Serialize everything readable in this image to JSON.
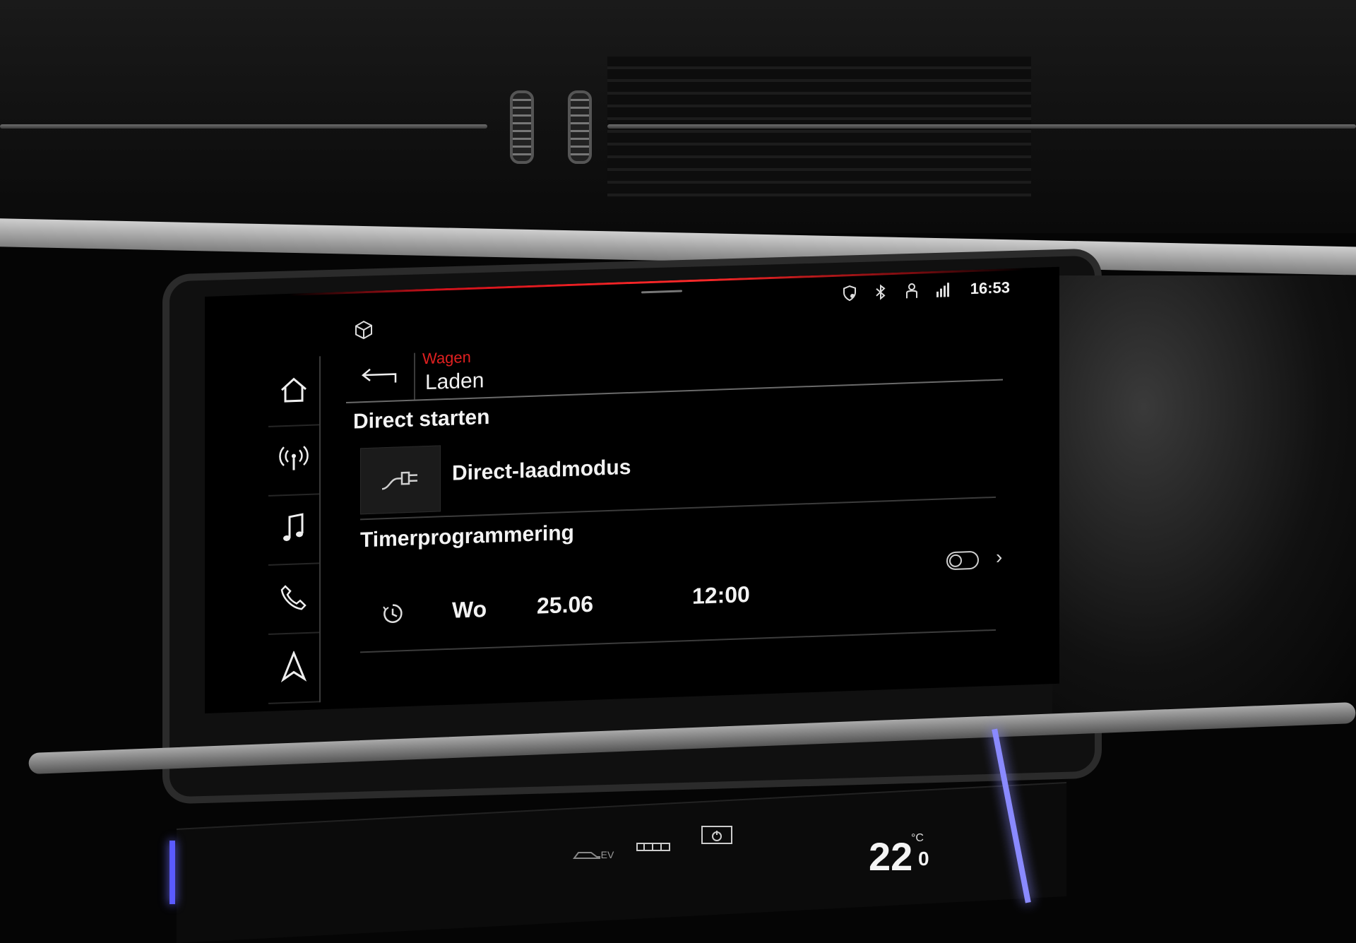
{
  "status_bar": {
    "time": "16:53",
    "icons": [
      "location-shield-icon",
      "bluetooth-icon",
      "passenger-icon",
      "signal-building-icon"
    ]
  },
  "breadcrumb": {
    "parent": "Wagen",
    "current": "Laden"
  },
  "sidebar": {
    "items": [
      "home-icon",
      "radio-antenna-icon",
      "music-note-icon",
      "phone-icon",
      "navigation-arrow-icon"
    ]
  },
  "direct_section": {
    "title": "Direct starten",
    "item_label": "Direct-laadmodus"
  },
  "timer_section": {
    "title": "Timerprogrammering",
    "day": "Wo",
    "date": "25.06",
    "time": "12:00",
    "enabled": false
  },
  "climate": {
    "ev_label": "EV",
    "temperature": "22",
    "temperature_decimal": "0",
    "unit": "°C"
  },
  "colors": {
    "accent_red": "#e02020",
    "background": "#000000",
    "text": "#f2f2f2",
    "ambient_blue": "#6a6aff"
  }
}
